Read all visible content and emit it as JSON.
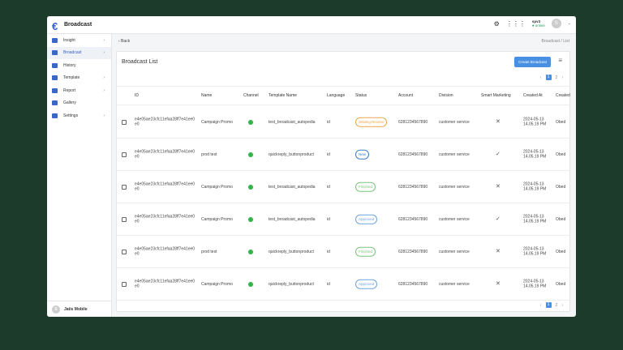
{
  "app": {
    "title": "Broadcast"
  },
  "topbar": {
    "user_name": "spv3",
    "user_status": "● online",
    "avatar_initial": "S"
  },
  "sidebar": {
    "items": [
      {
        "label": "Insight",
        "icon": "insight-icon",
        "chevron": true,
        "active": false
      },
      {
        "label": "Broadcast",
        "icon": "broadcast-icon",
        "chevron": true,
        "active": true
      },
      {
        "label": "History",
        "icon": "history-icon",
        "chevron": false,
        "active": false
      },
      {
        "label": "Template",
        "icon": "template-icon",
        "chevron": true,
        "active": false
      },
      {
        "label": "Report",
        "icon": "report-icon",
        "chevron": true,
        "active": false
      },
      {
        "label": "Gallery",
        "icon": "gallery-icon",
        "chevron": false,
        "active": false
      },
      {
        "label": "Settings",
        "icon": "gear-icon",
        "chevron": true,
        "active": false
      }
    ],
    "footer": {
      "name": "Jatis Mobile",
      "avatar_initial": "S"
    }
  },
  "nav": {
    "back": "‹  Back",
    "breadcrumb": "Broadcast / List"
  },
  "panel": {
    "title": "Broadcast List",
    "create_button": "Create Broadcast"
  },
  "pagination": {
    "pages": [
      "1",
      "2"
    ],
    "current": "1",
    "prev": "‹",
    "next": "›"
  },
  "table": {
    "columns": [
      "ID",
      "Name",
      "Channel",
      "Template Name",
      "Language",
      "Status",
      "Account",
      "Division",
      "Smart Marketing",
      "Created At",
      "Created"
    ],
    "rows": [
      {
        "id": "e4e05ae23cfc11efaa28ff7e41ee0e0",
        "name": "Campaign Promo",
        "template": "test_broadcast_autopedia",
        "language": "id",
        "status": "Waiting Review",
        "account": "6281234567890",
        "division": "customer service",
        "smart": "✕",
        "created_at": "2024-05-13 14.05.19 PM",
        "created_by": "Obed"
      },
      {
        "id": "e4e05ae23cfc11efaa28ff7e41ee0e0",
        "name": "prod test",
        "template": "quickreply_buttonproduct",
        "language": "id",
        "status": "New",
        "account": "6281234567890",
        "division": "customer service",
        "smart": "✓",
        "created_at": "2024-05-13 14.05.19 PM",
        "created_by": "Obed"
      },
      {
        "id": "e4e05ae23cfc11efaa28ff7e41ee0e0",
        "name": "Campaign Promo",
        "template": "test_broadcast_autopedia",
        "language": "id",
        "status": "Finished",
        "account": "6281234567890",
        "division": "customer service",
        "smart": "✕",
        "created_at": "2024-05-13 14.05.19 PM",
        "created_by": "Obed"
      },
      {
        "id": "e4e05ae23cfc11efaa28ff7e41ee0e0",
        "name": "Campaign Promo",
        "template": "test_broadcast_autopedia",
        "language": "id",
        "status": "Approved",
        "account": "6281234567890",
        "division": "customer service",
        "smart": "✓",
        "created_at": "2024-05-13 14.05.19 PM",
        "created_by": "Obed"
      },
      {
        "id": "e4e05ae23cfc11efaa28ff7e41ee0e0",
        "name": "prod test",
        "template": "quickreply_buttonproduct",
        "language": "id",
        "status": "Finished",
        "account": "6281234567890",
        "division": "customer service",
        "smart": "✕",
        "created_at": "2024-05-13 14.05.19 PM",
        "created_by": "Obed"
      },
      {
        "id": "e4e05ae23cfc11efaa28ff7e41ee0e0",
        "name": "Campaign Promo",
        "template": "quickreply_buttonproduct",
        "language": "id",
        "status": "Approved",
        "account": "6281234567890",
        "division": "customer service",
        "smart": "✕",
        "created_at": "2024-05-13 14.05.19 PM",
        "created_by": "Obed"
      }
    ]
  },
  "colors": {
    "accent": "#4a90e2",
    "Waiting Review": "#f0a64a",
    "New": "#3a7fc9",
    "Finished": "#7cc47a",
    "Approved": "#6fa3e0",
    "whatsapp": "#2fb34a"
  }
}
